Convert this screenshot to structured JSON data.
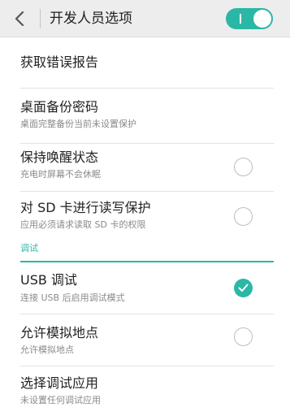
{
  "header": {
    "title": "开发人员选项",
    "developer_options_enabled": true
  },
  "accent_color": "#2bb7a6",
  "settings": [
    {
      "title": "获取错误报告"
    },
    {
      "title": "桌面备份密码",
      "subtitle": "桌面完整备份当前未设置保护"
    },
    {
      "title": "保持唤醒状态",
      "subtitle": "充电时屏幕不会休眠",
      "checked": false
    },
    {
      "title": "对 SD 卡进行读写保护",
      "subtitle": "应用必须请求读取 SD 卡的权限",
      "checked": false
    }
  ],
  "debug_section": {
    "label": "调试",
    "items": [
      {
        "title": "USB 调试",
        "subtitle": "连接 USB 后启用调试模式",
        "checked": true
      },
      {
        "title": "允许模拟地点",
        "subtitle": "允许模拟地点",
        "checked": false
      },
      {
        "title": "选择调试应用",
        "subtitle": "未设置任何调试应用"
      }
    ]
  }
}
